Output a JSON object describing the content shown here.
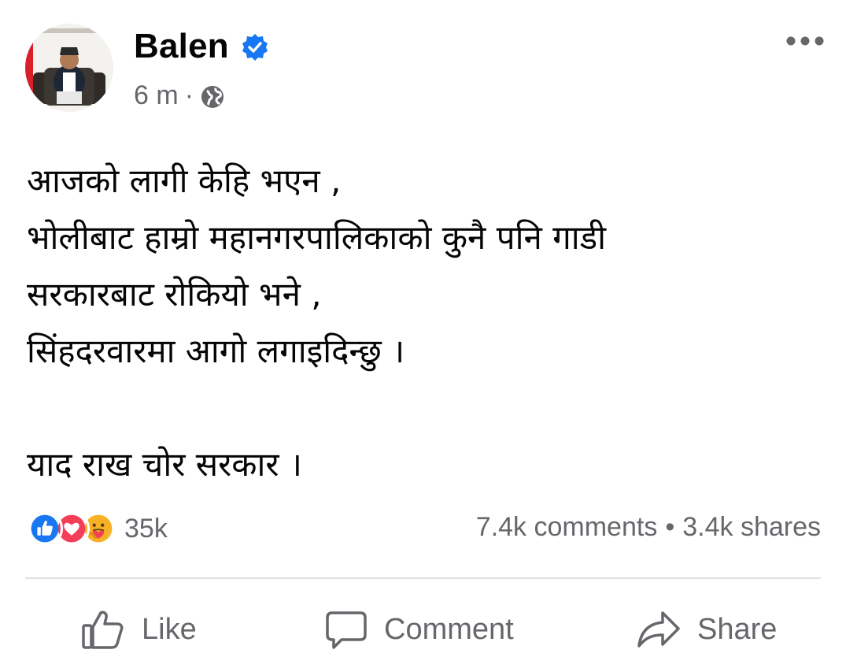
{
  "post": {
    "author": "Balen",
    "time": "6 m",
    "meta_separator": "·",
    "privacy_icon": "globe-icon",
    "verified_icon": "verified-badge-icon",
    "lines": [
      "आजको लागी केहि भएन ,",
      "भोलीबाट हाम्रो महानगरपालिकाको कुनै पनि गाडी",
      "सरकारबाट रोकियो भने ,",
      "सिंहदरवारमा आगो लगाइदिन्छु ।",
      "",
      "याद राख चोर सरकार ।"
    ]
  },
  "engagement": {
    "reaction_icons": [
      "like-reaction-icon",
      "love-reaction-icon",
      "care-reaction-icon"
    ],
    "reaction_count": "35k",
    "comments": "7.4k comments",
    "separator": "•",
    "shares": "3.4k shares"
  },
  "actions": {
    "like": "Like",
    "comment": "Comment",
    "share": "Share"
  },
  "colors": {
    "accent": "#1877f2",
    "love": "#f33e58",
    "care": "#f7b125",
    "secondary_text": "#65676b"
  }
}
